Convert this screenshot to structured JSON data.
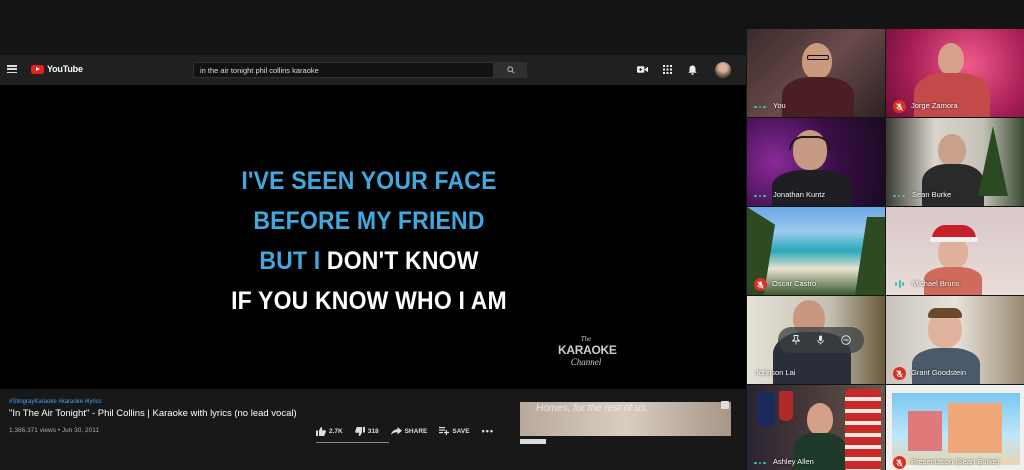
{
  "youtube": {
    "logo_text": "YouTube",
    "search": {
      "value": "in the air tonight phil collins karaoke"
    },
    "lyrics": {
      "line1": {
        "blue": "I'VE SEEN YOUR FACE",
        "white": ""
      },
      "line2": {
        "blue": "BEFORE MY FRIEND",
        "white": ""
      },
      "line3": {
        "blue": "BUT I",
        "white": " DON'T KNOW"
      },
      "line4": {
        "blue": "",
        "white": "IF YOU KNOW WHO I AM"
      }
    },
    "channel_logo": {
      "the": "The",
      "karaoke": "KARAOKE",
      "channel": "Channel"
    },
    "video": {
      "tags": "#StingrayKaraoke #karaoke #lyrics",
      "title": "\"In The Air Tonight\" - Phil Collins | Karaoke with lyrics (no lead vocal)",
      "meta": "1,386,371 views • Jun 30, 2011",
      "likes": "2.7K",
      "dislikes": "318",
      "share_label": "SHARE",
      "save_label": "SAVE"
    },
    "ad": {
      "text": "Homes, for the rest of us."
    },
    "colors": {
      "lyric_blue": "#3fa9e0",
      "logo_red": "#e62117",
      "tag_blue": "#3ea6ff"
    }
  },
  "participants": [
    {
      "name": "You",
      "status": "speaking-dots"
    },
    {
      "name": "Jorge Zamora",
      "status": "muted"
    },
    {
      "name": "Jonathan Kuntz",
      "status": "speaking-dots"
    },
    {
      "name": "Sean Burke",
      "status": "speaking-dots"
    },
    {
      "name": "Oscar Castro",
      "status": "muted"
    },
    {
      "name": "Michael Bruns",
      "status": "audio-bars"
    },
    {
      "name": "Johnson Lai",
      "status": "none"
    },
    {
      "name": "Grant Goodstein",
      "status": "muted"
    },
    {
      "name": "Ashley Allen",
      "status": "speaking-dots"
    },
    {
      "name": "Presentation (Sean Burke)",
      "status": "muted"
    }
  ],
  "meet_colors": {
    "muted_red": "#d93025",
    "speaking_teal": "#37c7b0"
  }
}
